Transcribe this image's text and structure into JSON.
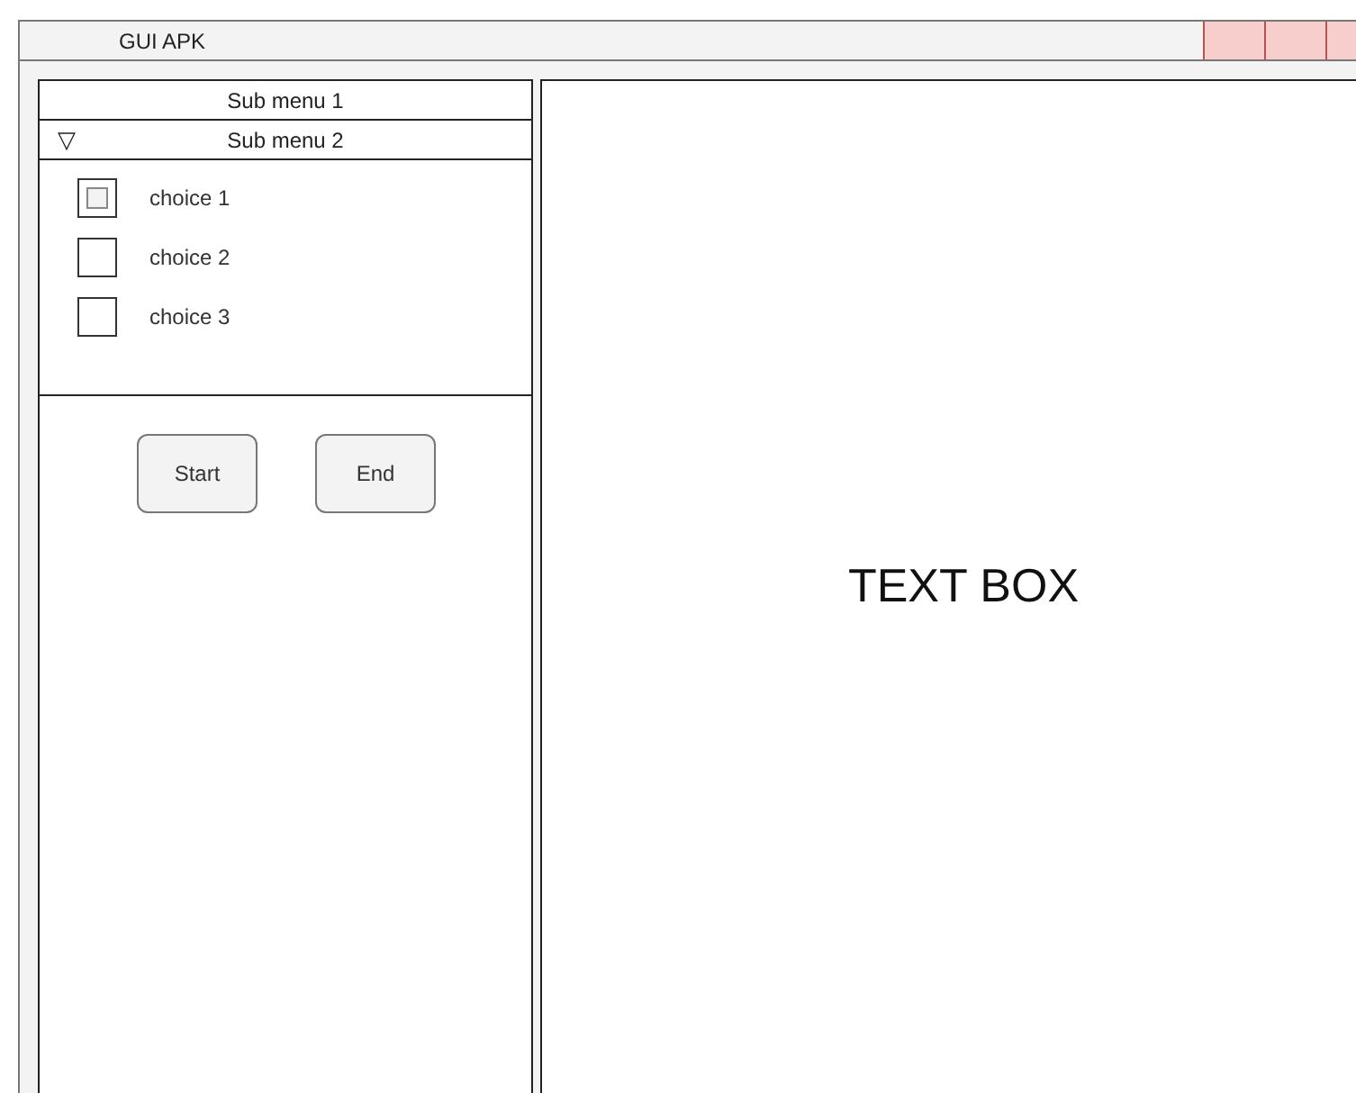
{
  "window": {
    "title": "GUI APK"
  },
  "sidebar": {
    "submenus": [
      {
        "label": "Sub menu 1"
      },
      {
        "label": "Sub menu 2",
        "marker": "▽",
        "choices": [
          {
            "label": "choice 1",
            "checked": true
          },
          {
            "label": "choice 2",
            "checked": false
          },
          {
            "label": "choice 3",
            "checked": false
          }
        ]
      }
    ],
    "buttons": [
      "Start",
      "End"
    ]
  },
  "text_box": {
    "text": "TEXT BOX"
  }
}
